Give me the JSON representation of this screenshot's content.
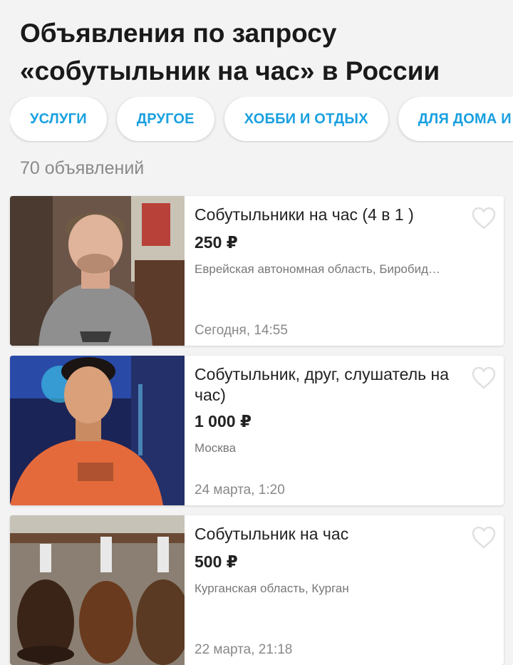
{
  "header": {
    "title_line1": "Объявления по запросу",
    "title_line2": "«собутыльник на час» в России"
  },
  "categories": [
    "УСЛУГИ",
    "ДРУГОЕ",
    "ХОББИ И ОТДЫХ",
    "ДЛЯ ДОМА И Д"
  ],
  "results_count": "70 объявлений",
  "listings": [
    {
      "title": "Собутыльники на час (4 в 1 )",
      "price": "250 ₽",
      "location": "Еврейская автономная область, Биробид…",
      "date": "Сегодня, 14:55",
      "image": "young-man-grey-tshirt-photo"
    },
    {
      "title": "Собутыльник, друг, слушатель на час)",
      "price": "1 000 ₽",
      "location": "Москва",
      "date": "24 марта, 1:20",
      "image": "man-orange-tshirt-concert-photo"
    },
    {
      "title": "Собутыльник на час",
      "price": "500 ₽",
      "location": "Курганская область, Курган",
      "date": "22 марта, 21:18",
      "image": "glass-bottles-with-gloves-photo"
    }
  ],
  "colors": {
    "accent": "#1aa0e0",
    "background": "#f3f3f3",
    "heart_outline": "#e0e0e0"
  }
}
